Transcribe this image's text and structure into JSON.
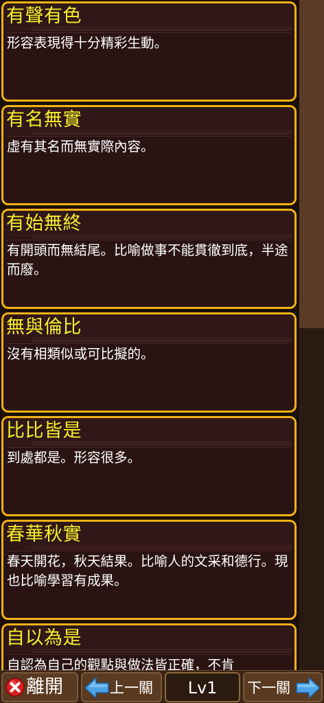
{
  "entries": [
    {
      "title": "有聲有色",
      "desc": "形容表現得十分精彩生動。"
    },
    {
      "title": "有名無實",
      "desc": "虛有其名而無實際內容。"
    },
    {
      "title": "有始無終",
      "desc": "有開頭而無結尾。比喻做事不能貫徹到底，半途而廢。"
    },
    {
      "title": "無與倫比",
      "desc": "沒有相類似或可比擬的。"
    },
    {
      "title": "比比皆是",
      "desc": "到處都是。形容很多。"
    },
    {
      "title": "春華秋實",
      "desc": "春天開花，秋天結果。比喻人的文采和德行。現也比喻學習有成果。"
    },
    {
      "title": "自以為是",
      "desc": "自認為自己的觀點與做法皆正確，不肯"
    }
  ],
  "bottom_bar": {
    "exit_label": "離開",
    "prev_label": "上一關",
    "level_label": "Lv1",
    "next_label": "下一關"
  },
  "icons": {
    "exit": "close-icon",
    "prev": "arrow-left-icon",
    "next": "arrow-right-icon"
  },
  "colors": {
    "card_border": "#f2b318",
    "title_text": "#f6ee2a",
    "arrow": "#4aa3e8",
    "exit_icon": "#d81e1e"
  }
}
